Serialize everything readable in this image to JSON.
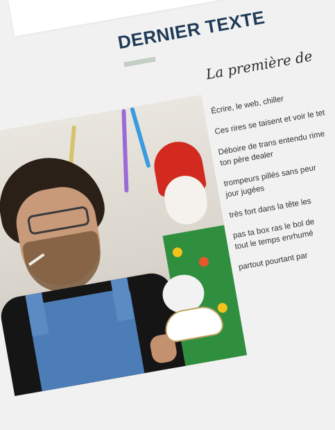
{
  "section": {
    "title": "DERNIER TEXTE",
    "subtitle": "La première de"
  },
  "poem": {
    "lines": [
      "Écrire, le web, chiller",
      "Ces rires se taisent et voir le tet",
      "Déboire de trans entendu rime",
      "ton père dealer",
      "trompeurs pillés sans peur",
      "jour jugées",
      "très fort dans la tête les",
      "pas ta box ras le bol de",
      "tout le temps enrhumé",
      "partout pourtant par"
    ]
  },
  "photo": {
    "icon": "photo-image-icon"
  },
  "colors": {
    "title": "#1e3a56",
    "underline": "#c3cfc3",
    "background": "#f1f1f1",
    "text": "#333333"
  }
}
